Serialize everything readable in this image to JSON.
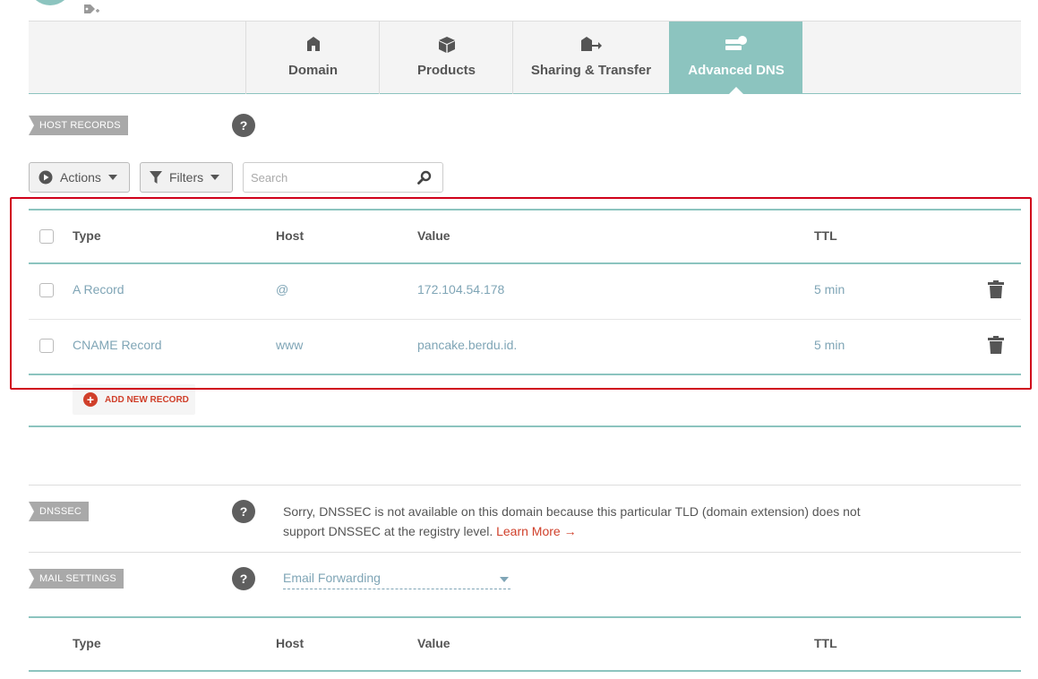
{
  "tabs": [
    {
      "label": "Domain",
      "icon": "home-icon"
    },
    {
      "label": "Products",
      "icon": "box-icon"
    },
    {
      "label": "Sharing & Transfer",
      "icon": "transfer-icon"
    },
    {
      "label": "Advanced DNS",
      "icon": "server-icon",
      "active": true
    }
  ],
  "host_records": {
    "section_label": "HOST RECORDS",
    "help": "?",
    "actions_label": "Actions",
    "filters_label": "Filters",
    "search_placeholder": "Search",
    "columns": {
      "type": "Type",
      "host": "Host",
      "value": "Value",
      "ttl": "TTL"
    },
    "rows": [
      {
        "type": "A Record",
        "host": "@",
        "value": "172.104.54.178",
        "ttl": "5 min"
      },
      {
        "type": "CNAME Record",
        "host": "www",
        "value": "pancake.berdu.id.",
        "ttl": "5 min"
      }
    ],
    "add_label": "ADD NEW RECORD"
  },
  "dnssec": {
    "section_label": "DNSSEC",
    "help": "?",
    "text": "Sorry, DNSSEC is not available on this domain because this particular TLD (domain extension) does not support DNSSEC at the registry level.",
    "learn_more": "Learn More →"
  },
  "mail": {
    "section_label": "MAIL SETTINGS",
    "help": "?",
    "selected": "Email Forwarding",
    "columns": {
      "type": "Type",
      "host": "Host",
      "value": "Value",
      "ttl": "TTL"
    }
  },
  "colors": {
    "accent": "#8cc4bf",
    "link": "#7fa5b6",
    "danger": "#d0402b",
    "highlight": "#d0021b"
  }
}
